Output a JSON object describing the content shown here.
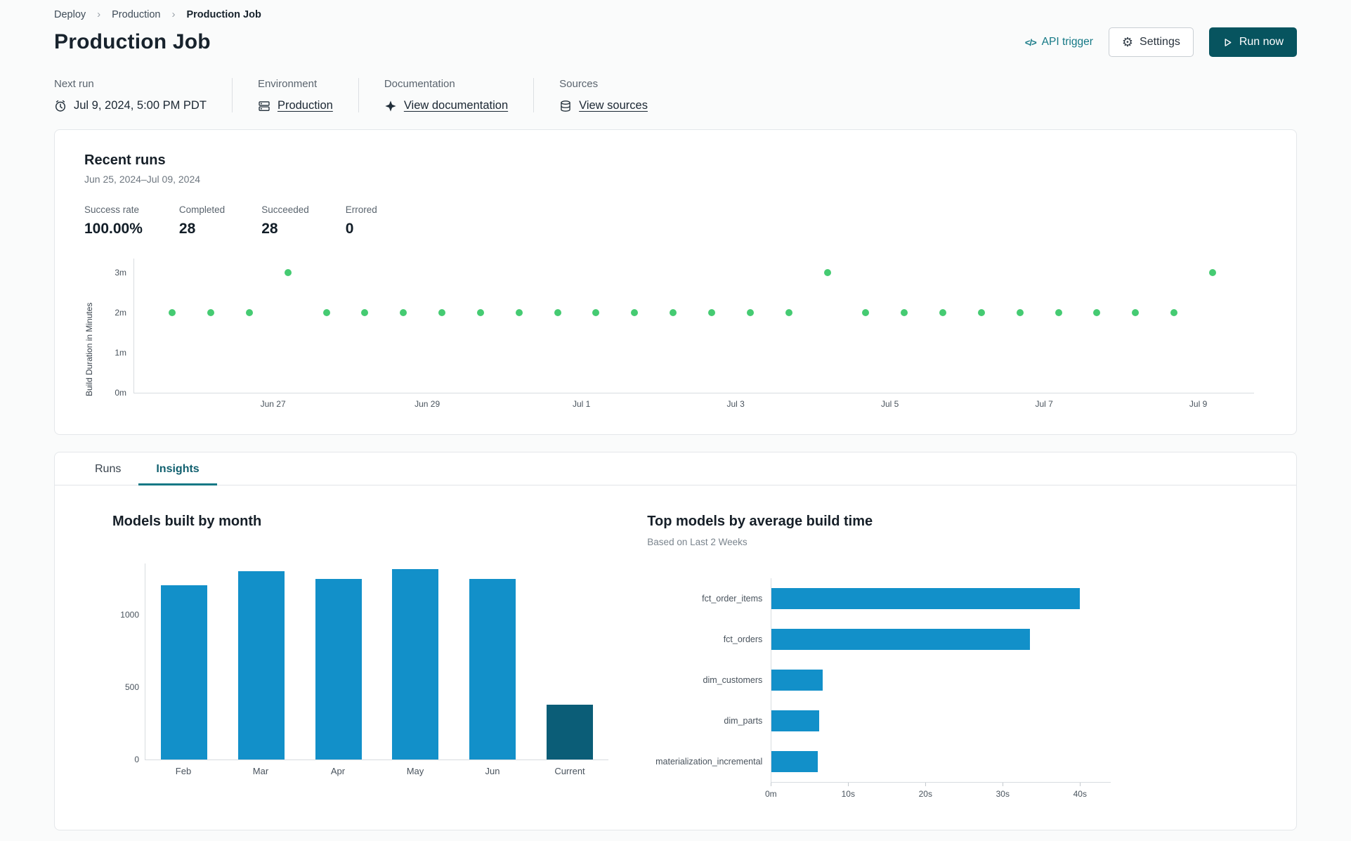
{
  "breadcrumb": {
    "separator": "›",
    "items": [
      {
        "label": "Deploy"
      },
      {
        "label": "Production"
      },
      {
        "label": "Production Job"
      }
    ]
  },
  "header": {
    "title": "Production Job",
    "api_trigger": {
      "icon": "</>",
      "label": "API trigger"
    },
    "settings_label": "Settings",
    "run_now_label": "Run now"
  },
  "job_meta": {
    "next_run": {
      "label": "Next run",
      "value": "Jul 9, 2024, 5:00 PM PDT"
    },
    "environment": {
      "label": "Environment",
      "value": "Production"
    },
    "documentation": {
      "label": "Documentation",
      "value": "View documentation"
    },
    "sources": {
      "label": "Sources",
      "value": "View sources"
    }
  },
  "recent_runs": {
    "title": "Recent runs",
    "date_range": "Jun 25, 2024–Jul 09, 2024",
    "stats": [
      {
        "label": "Success rate",
        "value": "100.00%"
      },
      {
        "label": "Completed",
        "value": "28"
      },
      {
        "label": "Succeeded",
        "value": "28"
      },
      {
        "label": "Errored",
        "value": "0"
      }
    ]
  },
  "tabs": [
    {
      "label": "Runs",
      "active": false
    },
    {
      "label": "Insights",
      "active": true
    }
  ],
  "colors": {
    "accent_teal": "#147885",
    "run_button": "#07545f",
    "dot_green": "#45cb72",
    "bar_blue": "#1290c9",
    "bar_dark_teal": "#0b5d77"
  },
  "chart_data": [
    {
      "type": "scatter",
      "name": "build-duration-per-run",
      "ylabel": "Build Duration in Minutes",
      "ylim_minutes": [
        0,
        3.35
      ],
      "y_ticks": [
        {
          "value": 0,
          "label": "0m"
        },
        {
          "value": 1,
          "label": "1m"
        },
        {
          "value": 2,
          "label": "2m"
        },
        {
          "value": 3,
          "label": "3m"
        }
      ],
      "x_ticks": [
        "Jun 27",
        "Jun 29",
        "Jul 1",
        "Jul 3",
        "Jul 5",
        "Jul 7",
        "Jul 9"
      ],
      "x_range": [
        "Jun 25, 2024",
        "Jul 09, 2024"
      ],
      "point_count": 28,
      "points_minutes": [
        2,
        2,
        2,
        3,
        2,
        2,
        2,
        2,
        2,
        2,
        2,
        2,
        2,
        2,
        2,
        2,
        2,
        3,
        2,
        2,
        2,
        2,
        2,
        2,
        2,
        2,
        2,
        3
      ]
    },
    {
      "type": "bar",
      "name": "models-built-by-month",
      "title": "Models built by month",
      "categories": [
        "Feb",
        "Mar",
        "Apr",
        "May",
        "Jun",
        "Current"
      ],
      "values": [
        1205,
        1300,
        1250,
        1315,
        1250,
        380
      ],
      "ylim": [
        0,
        1360
      ],
      "y_ticks": [
        {
          "value": 0,
          "label": "0"
        },
        {
          "value": 500,
          "label": "500"
        },
        {
          "value": 1000,
          "label": "1000"
        }
      ],
      "highlight_category": "Current"
    },
    {
      "type": "bar-horizontal",
      "name": "top-models-by-average-build-time",
      "title": "Top models by average build time",
      "subtitle": "Based on Last 2 Weeks",
      "categories": [
        "fct_order_items",
        "fct_orders",
        "dim_customers",
        "dim_parts",
        "materialization_incremental"
      ],
      "values_seconds": [
        40,
        33.5,
        6.6,
        6.2,
        6
      ],
      "xlim_seconds": [
        0,
        44
      ],
      "x_ticks": [
        {
          "value": 0,
          "label": "0m"
        },
        {
          "value": 10,
          "label": "10s"
        },
        {
          "value": 20,
          "label": "20s"
        },
        {
          "value": 30,
          "label": "30s"
        },
        {
          "value": 40,
          "label": "40s"
        }
      ]
    }
  ]
}
